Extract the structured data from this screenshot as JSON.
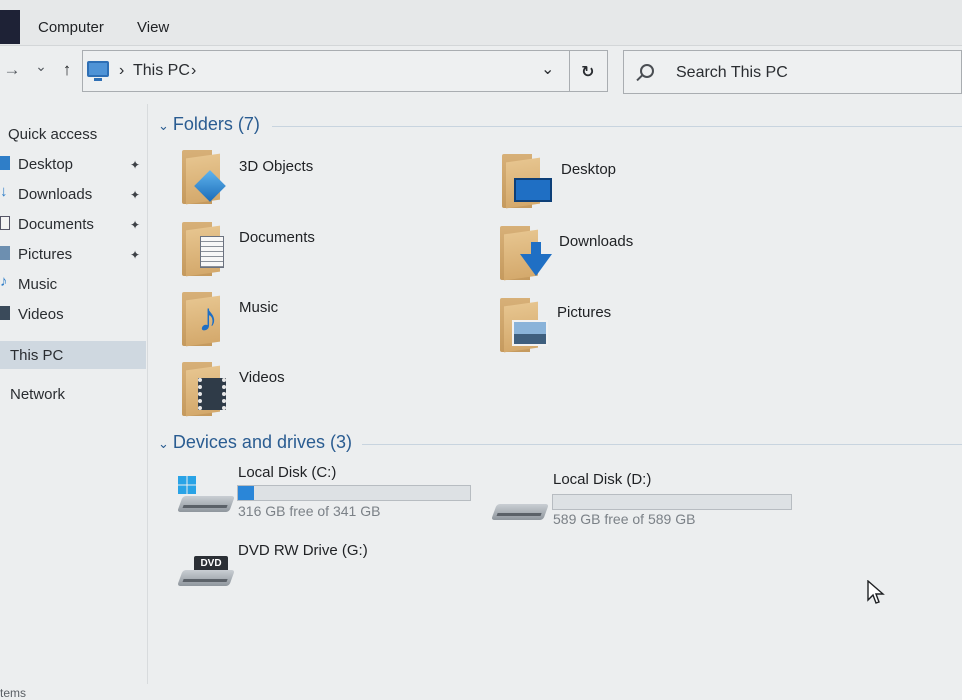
{
  "ribbon": {
    "tabs": [
      "Computer",
      "View"
    ]
  },
  "nav": {
    "forward": "→",
    "recent": "⌄",
    "up": "↑"
  },
  "address": {
    "separator_1": "›",
    "location": "This PC",
    "separator_2": "›",
    "dropdown": "⌄",
    "refresh": "↻"
  },
  "search": {
    "placeholder": "Search This PC"
  },
  "sidebar": {
    "quick_access": "Quick access",
    "items": [
      {
        "label": "Desktop",
        "pinned": true
      },
      {
        "label": "Downloads",
        "pinned": true
      },
      {
        "label": "Documents",
        "pinned": true
      },
      {
        "label": "Pictures",
        "pinned": true
      },
      {
        "label": "Music",
        "pinned": false
      },
      {
        "label": "Videos",
        "pinned": false
      }
    ],
    "this_pc": "This PC",
    "network": "Network",
    "pin_glyph": "📌"
  },
  "folders_section": {
    "title": "Folders (7)",
    "chevron": "⌄"
  },
  "folders": [
    {
      "label": "3D Objects",
      "icon": "cube-icon"
    },
    {
      "label": "Desktop",
      "icon": "desktop-icon"
    },
    {
      "label": "Documents",
      "icon": "document-icon"
    },
    {
      "label": "Downloads",
      "icon": "download-arrow-icon"
    },
    {
      "label": "Music",
      "icon": "music-note-icon"
    },
    {
      "label": "Pictures",
      "icon": "picture-icon"
    },
    {
      "label": "Videos",
      "icon": "film-icon"
    }
  ],
  "devices_section": {
    "title": "Devices and drives (3)",
    "chevron": "⌄"
  },
  "drives": [
    {
      "label": "Local Disk (C:)",
      "free": "316 GB free of 341 GB",
      "used_fraction": 0.07
    },
    {
      "label": "Local Disk (D:)",
      "free": "589 GB free of 589 GB",
      "used_fraction": 0.0
    },
    {
      "label": "DVD RW Drive (G:)",
      "badge": "DVD"
    }
  ],
  "status_bar": {
    "text": "tems"
  },
  "colors": {
    "accent": "#2a86d8",
    "section_header": "#2a5c91",
    "folder": "#d9b37a"
  }
}
